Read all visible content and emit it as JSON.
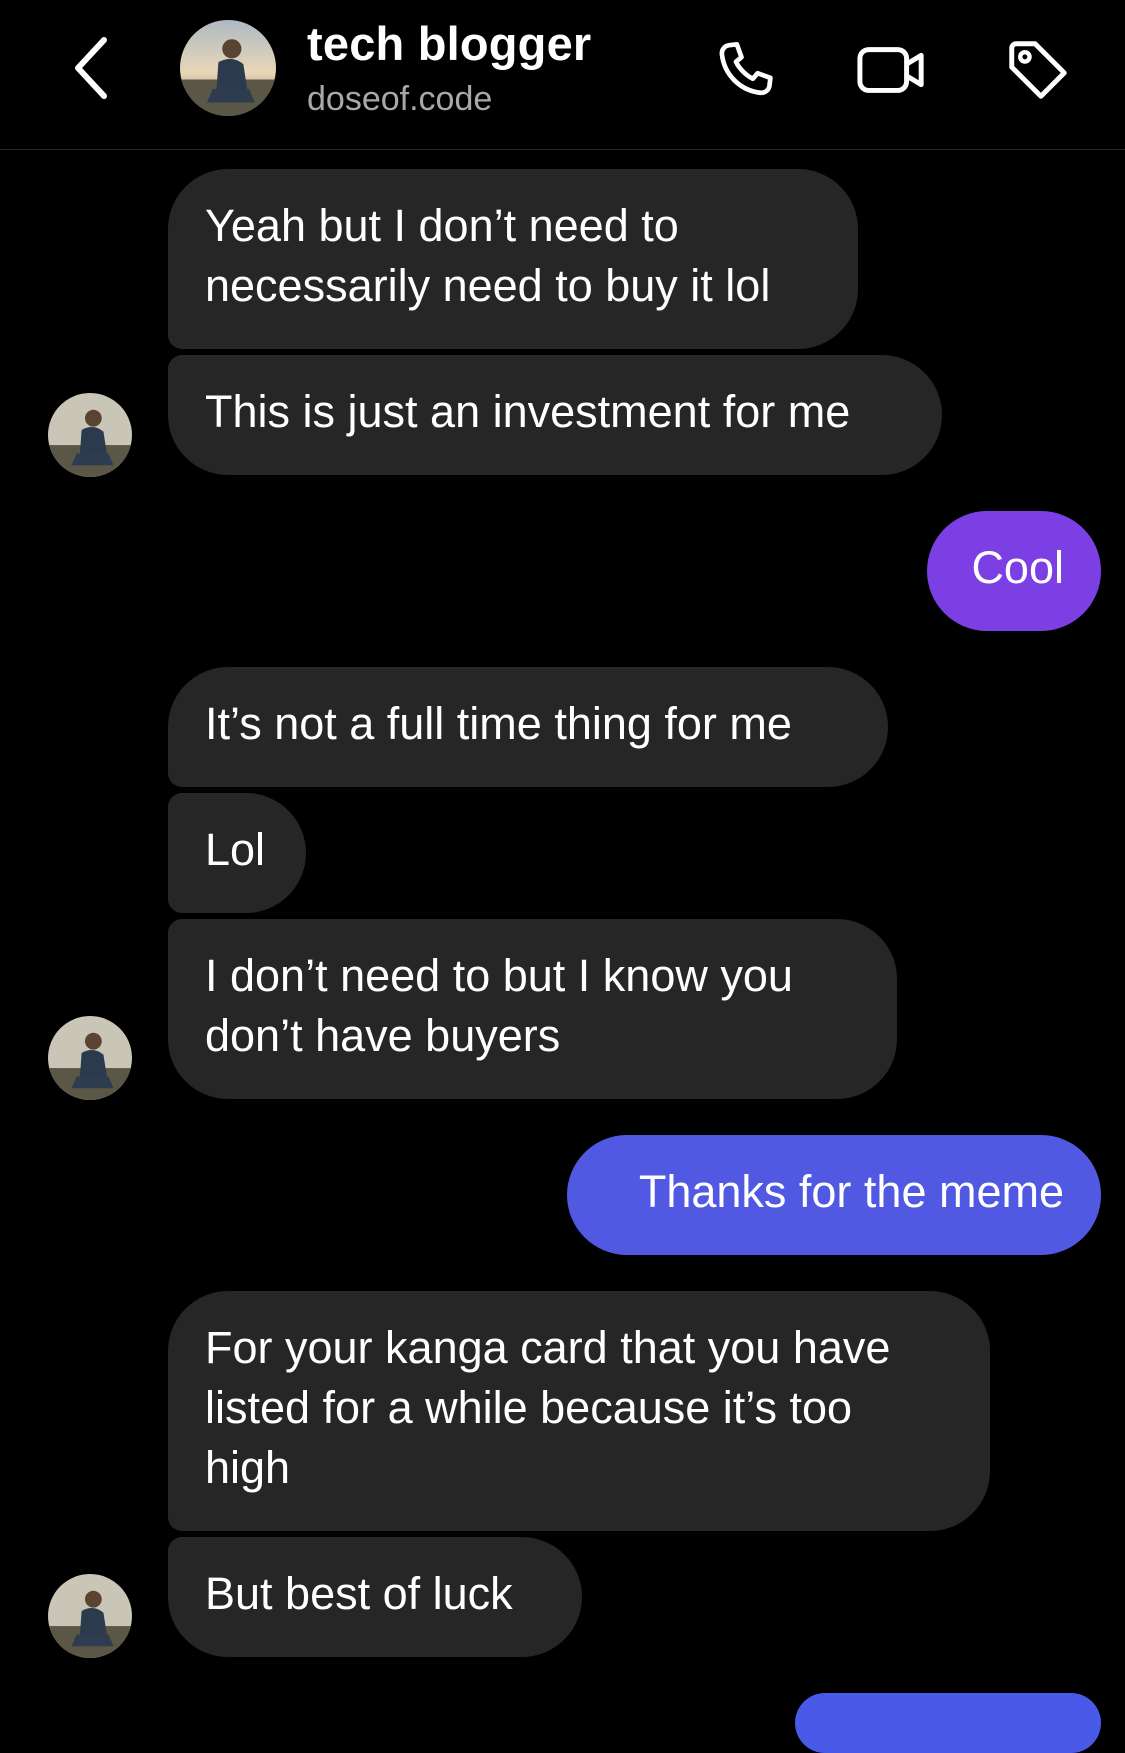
{
  "header": {
    "name": "tech blogger",
    "handle": "doseof.code",
    "icons": {
      "back": "chevron-left-icon",
      "call": "phone-icon",
      "video": "video-camera-icon",
      "tag": "tag-icon"
    }
  },
  "colors": {
    "background": "#000000",
    "incoming_bubble": "#262626",
    "outgoing_purple": "#7b3fe4",
    "outgoing_blue": "#5159e3",
    "secondary_text": "#a8a8a8"
  },
  "messages": [
    {
      "direction": "incoming",
      "text": "Yeah but I don’t need to\nnecessarily need to buy it lol"
    },
    {
      "direction": "incoming",
      "text": "This is just an investment for me"
    },
    {
      "direction": "outgoing",
      "text": "Cool"
    },
    {
      "direction": "incoming",
      "text": "It’s not a full time thing for me"
    },
    {
      "direction": "incoming",
      "text": "Lol"
    },
    {
      "direction": "incoming",
      "text": "I don’t need to but I know you\ndon’t have buyers"
    },
    {
      "direction": "outgoing",
      "text": "Thanks for the meme"
    },
    {
      "direction": "incoming",
      "text": "For your kanga card that you have\nlisted for a while because it’s too\nhigh"
    },
    {
      "direction": "incoming",
      "text": "But best of luck"
    }
  ]
}
